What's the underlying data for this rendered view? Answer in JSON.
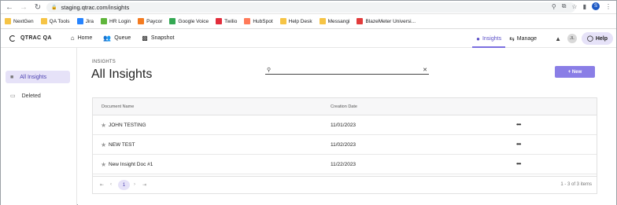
{
  "browser": {
    "url": "staging.qtrac.com/insights",
    "profile_initial": "S",
    "bookmarks": [
      {
        "label": "NextGen",
        "color": "#f6c445"
      },
      {
        "label": "QA Tools",
        "color": "#f6c445"
      },
      {
        "label": "Jira",
        "color": "#2684ff"
      },
      {
        "label": "HR Login",
        "color": "#5fb53b"
      },
      {
        "label": "Paycor",
        "color": "#f47b20"
      },
      {
        "label": "Google Voice",
        "color": "#34a853"
      },
      {
        "label": "Twilio",
        "color": "#e22d3b"
      },
      {
        "label": "HubSpot",
        "color": "#ff7a59"
      },
      {
        "label": "Help Desk",
        "color": "#f6c445"
      },
      {
        "label": "Messangi",
        "color": "#f6c445"
      },
      {
        "label": "BlazeMeter Universi...",
        "color": "#e23b3b"
      }
    ]
  },
  "app": {
    "logo_text": "QTRAC QA",
    "nav": [
      {
        "label": "Home",
        "icon": "home-icon"
      },
      {
        "label": "Queue",
        "icon": "people-icon"
      },
      {
        "label": "Snapshot",
        "icon": "bar-chart-icon"
      }
    ],
    "right_nav": [
      {
        "label": "Insights",
        "icon": "lightbulb-icon",
        "active": true
      },
      {
        "label": "Manage",
        "icon": "sliders-icon",
        "active": false
      }
    ],
    "avatar_initials": "JL",
    "help_label": "Help"
  },
  "sidebar": {
    "items": [
      {
        "label": "All Insights",
        "icon": "folder-icon",
        "active": true
      },
      {
        "label": "Deleted",
        "icon": "trash-icon",
        "active": false
      }
    ]
  },
  "main": {
    "breadcrumb": "INSIGHTS",
    "title": "All Insights",
    "search_placeholder": "",
    "new_button": "+ New",
    "columns": {
      "name": "Document Name",
      "date": "Creation Date"
    },
    "rows": [
      {
        "name": "JOHN TESTING",
        "date": "11/01/2023"
      },
      {
        "name": "NEW TEST",
        "date": "11/02/2023"
      },
      {
        "name": "New Insight Doc #1",
        "date": "11/22/2023"
      }
    ],
    "pager": {
      "current": "1",
      "info": "1 - 3 of 3 items"
    }
  },
  "colors": {
    "accent": "#8a7ee6",
    "accent_light": "#e6e2f8",
    "active_text": "#4a3fb0"
  }
}
